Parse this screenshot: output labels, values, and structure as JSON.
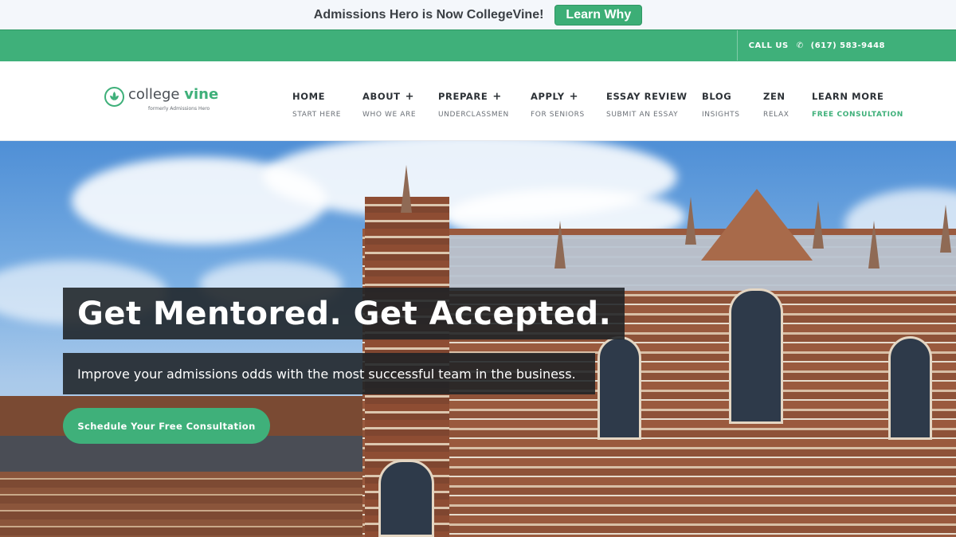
{
  "announcement": {
    "text": "Admissions Hero is Now CollegeVine!",
    "button_label": "Learn Why"
  },
  "contact_bar": {
    "call_label": "CALL US",
    "phone_icon": "phone-icon",
    "phone": "(617) 583-9448"
  },
  "logo": {
    "name_part1": "college",
    "name_part2": "vine",
    "subtitle": "formerly Admissions Hero"
  },
  "nav": {
    "items": [
      {
        "title": "HOME",
        "sub": "START HERE",
        "has_plus": false
      },
      {
        "title": "ABOUT",
        "sub": "WHO WE ARE",
        "has_plus": true
      },
      {
        "title": "PREPARE",
        "sub": "UNDERCLASSMEN",
        "has_plus": true
      },
      {
        "title": "APPLY",
        "sub": "FOR SENIORS",
        "has_plus": true
      },
      {
        "title": "ESSAY REVIEW",
        "sub": "SUBMIT AN ESSAY",
        "has_plus": false
      },
      {
        "title": "BLOG",
        "sub": "INSIGHTS",
        "has_plus": false
      },
      {
        "title": "ZEN",
        "sub": "RELAX",
        "has_plus": false
      },
      {
        "title": "LEARN MORE",
        "sub": "FREE CONSULTATION",
        "has_plus": false
      }
    ],
    "plus_symbol": "+"
  },
  "hero": {
    "headline": "Get Mentored. Get Accepted.",
    "subheadline": "Improve your admissions odds with the most successful team in the business.",
    "cta_label": "Schedule Your Free Consultation"
  },
  "colors": {
    "brand_green": "#3fb07a",
    "dark_text": "#2c3136"
  }
}
